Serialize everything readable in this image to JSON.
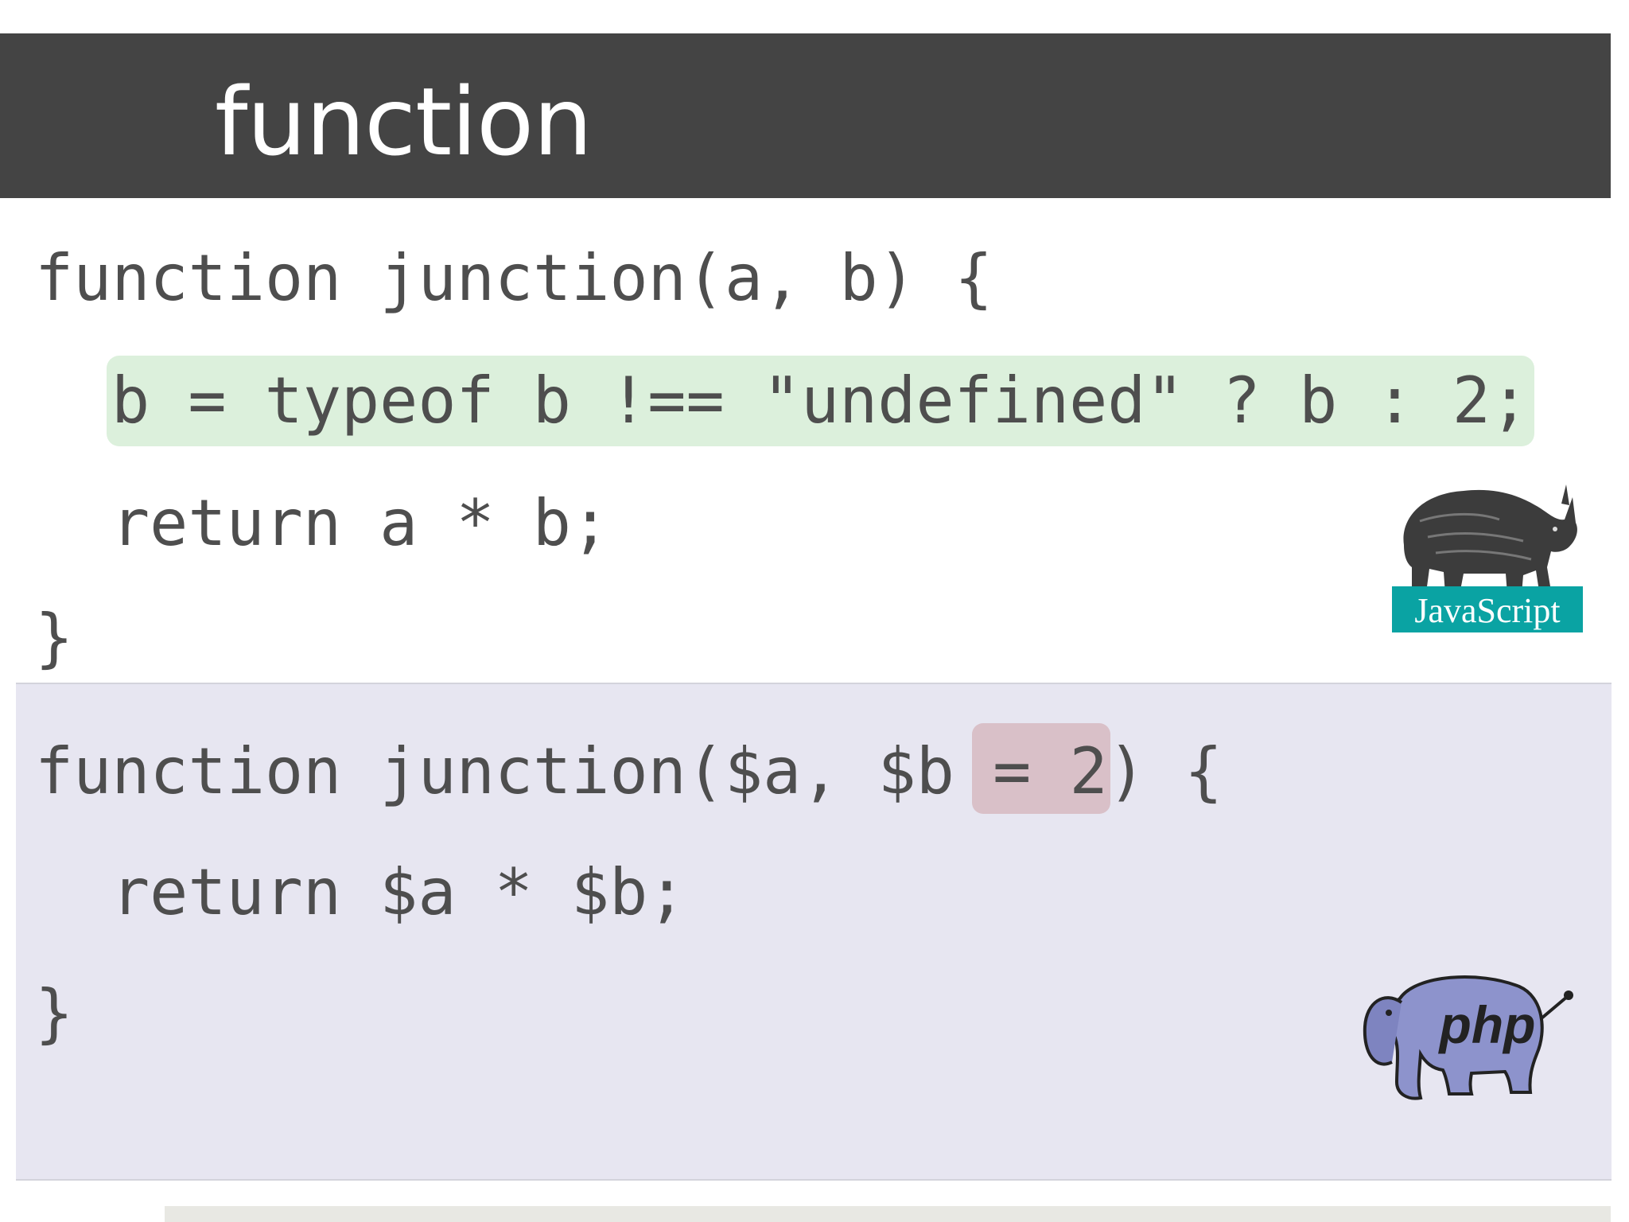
{
  "slide": {
    "title": "function"
  },
  "js_code": {
    "line1": "function junction(a, b) {",
    "line2": "b = typeof b !== \"undefined\" ? b : 2;",
    "line3": "return a * b;",
    "line4": "}"
  },
  "php_code": {
    "line1_pre": "function junction($a, $b ",
    "line1_highlight": "= 2",
    "line1_post": ") {",
    "line2": "return $a * $b;",
    "line3": "}"
  },
  "logos": {
    "javascript_label": "JavaScript",
    "php_label": "php"
  },
  "colors": {
    "title_bar": "#444444",
    "js_highlight": "#dcf0dc",
    "php_panel": "#e7e6f1",
    "php_highlight": "#d9c0c8",
    "js_logo_band": "#0aa3a3",
    "php_logo_body": "#8d93cc"
  },
  "icons": [
    "rhino-javascript-logo-icon",
    "elephant-php-logo-icon"
  ]
}
